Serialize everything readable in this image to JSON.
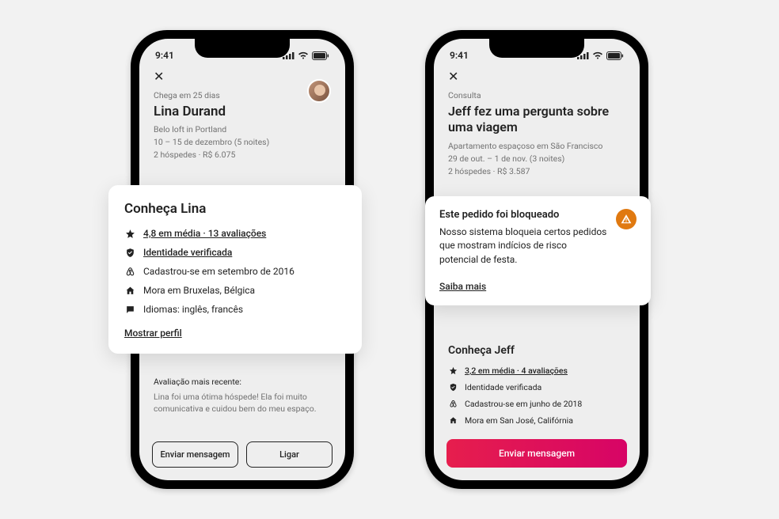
{
  "status": {
    "time": "9:41"
  },
  "left": {
    "meta": "Chega em 25 dias",
    "name": "Lina Durand",
    "line1": "Belo loft in Portland",
    "line2": "10 – 15 de dezembro (5 noites)",
    "line3": "2 hóspedes · R$ 6.075",
    "card": {
      "title": "Conheça Lina",
      "rating": "4,8 em média · 13 avaliações",
      "identity": "Identidade verificada",
      "joined": "Cadastrou-se em setembro de 2016",
      "lives": "Mora em Bruxelas, Bélgica",
      "languages": "Idiomas: inglês, francês",
      "show_profile": "Mostrar perfil"
    },
    "review": {
      "label": "Avaliação mais recente:",
      "text": "Lina foi uma ótima hóspede! Ela foi muito comunicativa e cuidou bem do meu espaço."
    },
    "buttons": {
      "message": "Enviar mensagem",
      "call": "Ligar"
    }
  },
  "right": {
    "meta": "Consulta",
    "title": "Jeff fez uma pergunta sobre uma viagem",
    "line1": "Apartamento espaçoso em São Francisco",
    "line2": "29 de out. – 1 de nov. (3 noites)",
    "line3": "2 hóspedes · R$ 3.587",
    "blocked": {
      "title": "Este pedido foi bloqueado",
      "text": "Nosso sistema bloqueia certos pedidos que mostram indícios de risco potencial de festa.",
      "learn_more": "Saiba mais"
    },
    "meet": {
      "title": "Conheça Jeff",
      "rating": "3,2 em média · 4 avaliações",
      "identity": "Identidade verificada",
      "joined": "Cadastrou-se em junho de 2018",
      "lives": "Mora em San José, Califórnia"
    },
    "button": "Enviar mensagem"
  }
}
